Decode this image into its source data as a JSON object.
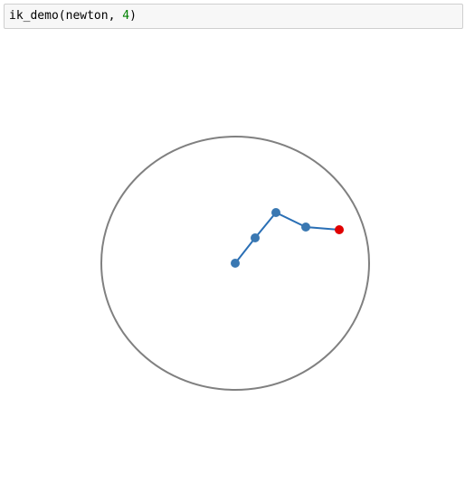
{
  "cell": {
    "code_prefix": "ik_demo(newton, ",
    "code_number": "4",
    "code_suffix": ")"
  },
  "figure": {
    "circle_color": "#808080",
    "arm_color": "#2a6fb5",
    "joint_color": "#3a78b2",
    "target_color": "#e00000"
  }
}
